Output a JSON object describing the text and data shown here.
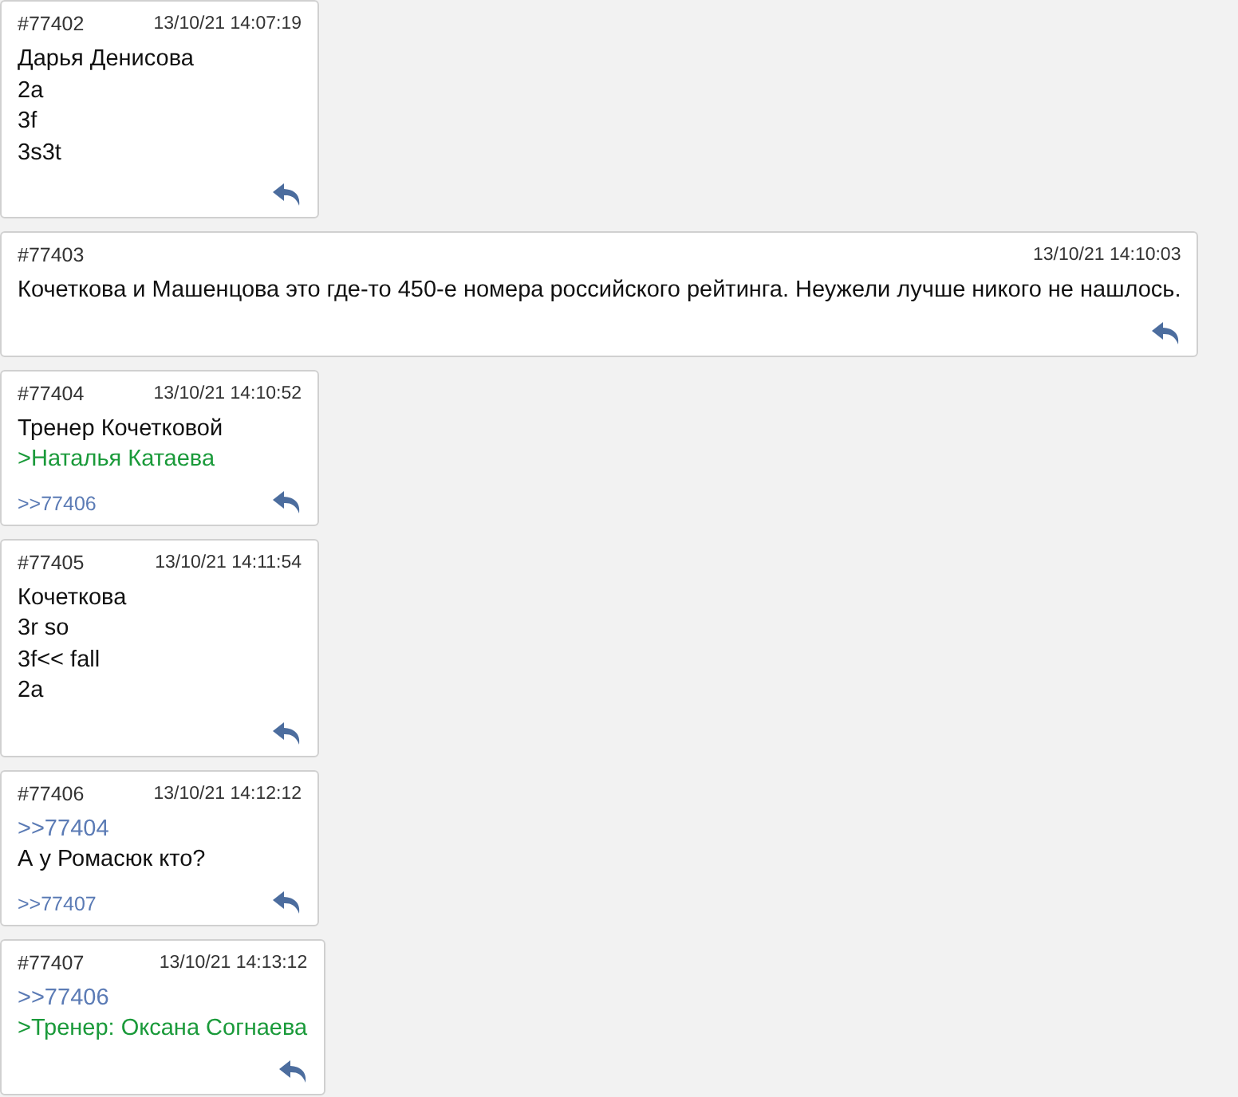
{
  "posts": [
    {
      "number": "#77402",
      "date": "13/10/21 14:07:19",
      "lines": [
        {
          "kind": "text",
          "text": "Дарья Денисова"
        },
        {
          "kind": "text",
          "text": "2a"
        },
        {
          "kind": "text",
          "text": "3f"
        },
        {
          "kind": "text",
          "text": "3s3t"
        }
      ]
    },
    {
      "number": "#77403",
      "date": "13/10/21 14:10:03",
      "lines": [
        {
          "kind": "text",
          "text": "Кочеткова и Машенцова это где-то 450-е номера российского рейтинга. Неужели лучше никого не нашлось."
        }
      ]
    },
    {
      "number": "#77404",
      "date": "13/10/21 14:10:52",
      "lines": [
        {
          "kind": "text",
          "text": "Тренер Кочетковой"
        },
        {
          "kind": "quote",
          "text": ">Наталья Катаева"
        }
      ],
      "backlinks": [
        ">>77406"
      ]
    },
    {
      "number": "#77405",
      "date": "13/10/21 14:11:54",
      "lines": [
        {
          "kind": "text",
          "text": "Кочеткова"
        },
        {
          "kind": "text",
          "text": "3r so"
        },
        {
          "kind": "text",
          "text": "3f<< fall"
        },
        {
          "kind": "text",
          "text": "2a"
        }
      ]
    },
    {
      "number": "#77406",
      "date": "13/10/21 14:12:12",
      "lines": [
        {
          "kind": "link",
          "text": ">>77404"
        },
        {
          "kind": "text",
          "text": "А у Ромасюк кто?"
        }
      ],
      "backlinks": [
        ">>77407"
      ]
    },
    {
      "number": "#77407",
      "date": "13/10/21 14:13:12",
      "lines": [
        {
          "kind": "link",
          "text": ">>77406"
        },
        {
          "kind": "quote",
          "text": ">Тренер: Оксана Согнаева"
        }
      ]
    }
  ]
}
